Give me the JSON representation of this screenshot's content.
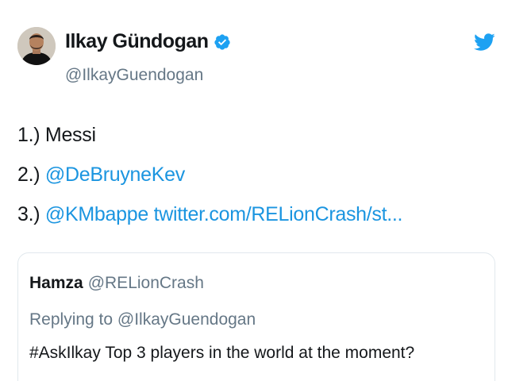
{
  "author": {
    "display_name": "Ilkay Gündogan",
    "handle": "@IlkayGuendogan",
    "verified": true
  },
  "tweet": {
    "lines": [
      {
        "prefix": "1.) ",
        "text": "Messi",
        "link": ""
      },
      {
        "prefix": "2.) ",
        "text": "",
        "link": "@DeBruyneKev"
      },
      {
        "prefix": "3.) ",
        "text": "",
        "link": "@KMbappe twitter.com/RELionCrash/st..."
      }
    ]
  },
  "quoted_tweet": {
    "name": "Hamza",
    "handle": "@RELionCrash",
    "replying_to": "Replying to @IlkayGuendogan",
    "text": "#AskIlkay Top 3 players in the world at the moment?"
  },
  "colors": {
    "link": "#1b95e0",
    "muted": "#657786",
    "text": "#14171a",
    "border": "#e1e8ed"
  },
  "icons": [
    "avatar",
    "verified-badge-icon",
    "twitter-bird-icon"
  ]
}
